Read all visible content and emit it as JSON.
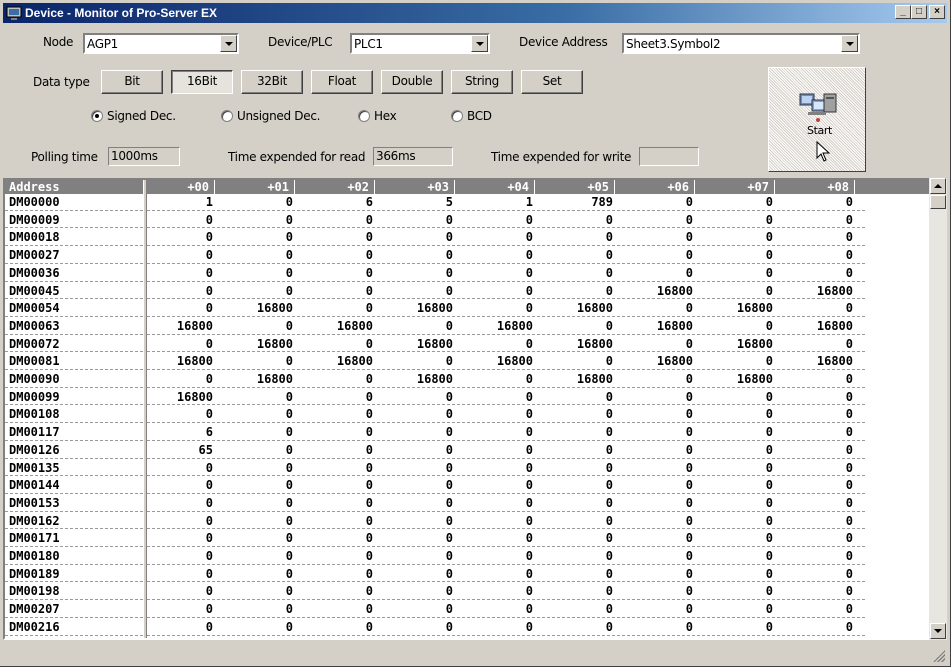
{
  "window": {
    "title": "Device - Monitor of Pro-Server EX",
    "minimize": "_",
    "maximize": "□",
    "close": "×"
  },
  "node": {
    "label": "Node",
    "value": "AGP1"
  },
  "device_plc": {
    "label": "Device/PLC",
    "value": "PLC1"
  },
  "device_address": {
    "label": "Device Address",
    "value": "Sheet3.Symbol2"
  },
  "data_type": {
    "label": "Data type",
    "buttons": [
      "Bit",
      "16Bit",
      "32Bit",
      "Float",
      "Double",
      "String",
      "Set"
    ],
    "selected": "16Bit"
  },
  "format": {
    "options": [
      "Signed Dec.",
      "Unsigned Dec.",
      "Hex",
      "BCD"
    ],
    "selected": "Signed Dec."
  },
  "polling": {
    "label": "Polling time",
    "value": "1000ms"
  },
  "read_time": {
    "label": "Time expended for read",
    "value": "366ms"
  },
  "write_time": {
    "label": "Time expended for write",
    "value": ""
  },
  "start_button": {
    "label": "Start",
    "icon": "computers-network-icon"
  },
  "grid": {
    "address_header": "Address",
    "columns": [
      "+00",
      "+01",
      "+02",
      "+03",
      "+04",
      "+05",
      "+06",
      "+07",
      "+08"
    ],
    "rows": [
      {
        "addr": "DM00000",
        "vals": [
          "1",
          "0",
          "6",
          "5",
          "1",
          "789",
          "0",
          "0",
          "0"
        ]
      },
      {
        "addr": "DM00009",
        "vals": [
          "0",
          "0",
          "0",
          "0",
          "0",
          "0",
          "0",
          "0",
          "0"
        ]
      },
      {
        "addr": "DM00018",
        "vals": [
          "0",
          "0",
          "0",
          "0",
          "0",
          "0",
          "0",
          "0",
          "0"
        ]
      },
      {
        "addr": "DM00027",
        "vals": [
          "0",
          "0",
          "0",
          "0",
          "0",
          "0",
          "0",
          "0",
          "0"
        ]
      },
      {
        "addr": "DM00036",
        "vals": [
          "0",
          "0",
          "0",
          "0",
          "0",
          "0",
          "0",
          "0",
          "0"
        ]
      },
      {
        "addr": "DM00045",
        "vals": [
          "0",
          "0",
          "0",
          "0",
          "0",
          "0",
          "16800",
          "0",
          "16800"
        ]
      },
      {
        "addr": "DM00054",
        "vals": [
          "0",
          "16800",
          "0",
          "16800",
          "0",
          "16800",
          "0",
          "16800",
          "0"
        ]
      },
      {
        "addr": "DM00063",
        "vals": [
          "16800",
          "0",
          "16800",
          "0",
          "16800",
          "0",
          "16800",
          "0",
          "16800"
        ]
      },
      {
        "addr": "DM00072",
        "vals": [
          "0",
          "16800",
          "0",
          "16800",
          "0",
          "16800",
          "0",
          "16800",
          "0"
        ]
      },
      {
        "addr": "DM00081",
        "vals": [
          "16800",
          "0",
          "16800",
          "0",
          "16800",
          "0",
          "16800",
          "0",
          "16800"
        ]
      },
      {
        "addr": "DM00090",
        "vals": [
          "0",
          "16800",
          "0",
          "16800",
          "0",
          "16800",
          "0",
          "16800",
          "0"
        ]
      },
      {
        "addr": "DM00099",
        "vals": [
          "16800",
          "0",
          "0",
          "0",
          "0",
          "0",
          "0",
          "0",
          "0"
        ]
      },
      {
        "addr": "DM00108",
        "vals": [
          "0",
          "0",
          "0",
          "0",
          "0",
          "0",
          "0",
          "0",
          "0"
        ]
      },
      {
        "addr": "DM00117",
        "vals": [
          "6",
          "0",
          "0",
          "0",
          "0",
          "0",
          "0",
          "0",
          "0"
        ]
      },
      {
        "addr": "DM00126",
        "vals": [
          "65",
          "0",
          "0",
          "0",
          "0",
          "0",
          "0",
          "0",
          "0"
        ]
      },
      {
        "addr": "DM00135",
        "vals": [
          "0",
          "0",
          "0",
          "0",
          "0",
          "0",
          "0",
          "0",
          "0"
        ]
      },
      {
        "addr": "DM00144",
        "vals": [
          "0",
          "0",
          "0",
          "0",
          "0",
          "0",
          "0",
          "0",
          "0"
        ]
      },
      {
        "addr": "DM00153",
        "vals": [
          "0",
          "0",
          "0",
          "0",
          "0",
          "0",
          "0",
          "0",
          "0"
        ]
      },
      {
        "addr": "DM00162",
        "vals": [
          "0",
          "0",
          "0",
          "0",
          "0",
          "0",
          "0",
          "0",
          "0"
        ]
      },
      {
        "addr": "DM00171",
        "vals": [
          "0",
          "0",
          "0",
          "0",
          "0",
          "0",
          "0",
          "0",
          "0"
        ]
      },
      {
        "addr": "DM00180",
        "vals": [
          "0",
          "0",
          "0",
          "0",
          "0",
          "0",
          "0",
          "0",
          "0"
        ]
      },
      {
        "addr": "DM00189",
        "vals": [
          "0",
          "0",
          "0",
          "0",
          "0",
          "0",
          "0",
          "0",
          "0"
        ]
      },
      {
        "addr": "DM00198",
        "vals": [
          "0",
          "0",
          "0",
          "0",
          "0",
          "0",
          "0",
          "0",
          "0"
        ]
      },
      {
        "addr": "DM00207",
        "vals": [
          "0",
          "0",
          "0",
          "0",
          "0",
          "0",
          "0",
          "0",
          "0"
        ]
      },
      {
        "addr": "DM00216",
        "vals": [
          "0",
          "0",
          "0",
          "0",
          "0",
          "0",
          "0",
          "0",
          "0"
        ]
      }
    ]
  },
  "colors": {
    "title_gradient_start": "#0a246a",
    "title_gradient_end": "#a6caf0",
    "face": "#d4d0c8",
    "grid_header": "#808080"
  }
}
